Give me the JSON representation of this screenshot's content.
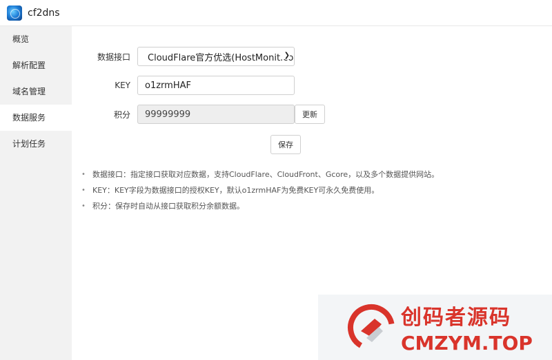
{
  "app": {
    "title": "cf2dns",
    "icon": "app-logo-icon"
  },
  "sidebar": {
    "items": [
      {
        "label": "概览",
        "active": false
      },
      {
        "label": "解析配置",
        "active": false
      },
      {
        "label": "域名管理",
        "active": false
      },
      {
        "label": "数据服务",
        "active": true
      },
      {
        "label": "计划任务",
        "active": false
      }
    ]
  },
  "form": {
    "interface": {
      "label": "数据接口",
      "value": "CloudFlare官方优选(HostMonit.co"
    },
    "key": {
      "label": "KEY",
      "value": "o1zrmHAF"
    },
    "points": {
      "label": "积分",
      "value": "99999999",
      "refresh_label": "更新"
    },
    "save_label": "保存"
  },
  "notes": [
    "数据接口：指定接口获取对应数据，支持CloudFlare、CloudFront、Gcore，以及多个数据提供网站。",
    "KEY：KEY字段为数据接口的授权KEY，默认o1zrmHAF为免费KEY可永久免费使用。",
    "积分：保存时自动从接口获取积分余额数据。"
  ],
  "watermark": {
    "cn": "创码者源码",
    "en": "CMZYM.TOP"
  },
  "colors": {
    "sidebar_bg": "#f2f2f2",
    "active_item_bg": "#ffffff",
    "watermark_red": "#d9342b"
  }
}
